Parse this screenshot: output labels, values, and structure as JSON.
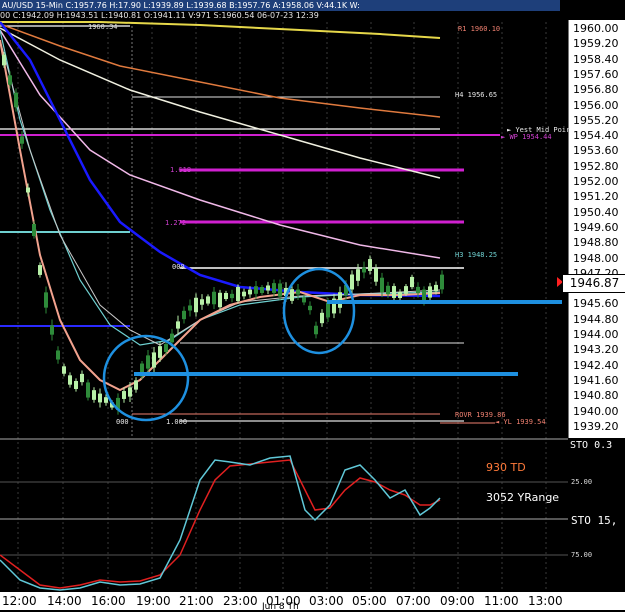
{
  "window": {
    "title": "AU/USD 15-Min  C:1957.76  H:17.90  L:1939.89  L:1939.68  B:1957.76  A:1958.06  V:44.1K  W:",
    "ohlc_line": "00  C:1942.09  H:1943.51  L:1940.81  O:1941.11  V:971  S:1960.54  06-07-23  12:39",
    "top_left_value": "1960.34"
  },
  "price_axis": {
    "labels": [
      "1960.00",
      "1959.20",
      "1958.40",
      "1957.60",
      "1956.80",
      "1956.00",
      "1955.20",
      "1954.40",
      "1953.60",
      "1952.80",
      "1952.00",
      "1951.20",
      "1950.40",
      "1949.60",
      "1948.80",
      "1948.00",
      "1947.20",
      "1946.40",
      "1945.60",
      "1944.80",
      "1944.00",
      "1943.20",
      "1942.40",
      "1941.60",
      "1940.80",
      "1940.00",
      "1939.20"
    ],
    "current_price": "1946.87"
  },
  "time_axis": {
    "labels": [
      "12:00",
      "14:00",
      "16:00",
      "19:00",
      "21:00",
      "23:00",
      "01:00",
      "03:00",
      "05:00",
      "07:00",
      "09:00",
      "11:00",
      "13:00"
    ],
    "footer_fragment": "Jun 8 Th"
  },
  "level_labels": {
    "r1": "R1 1960.10",
    "h4": "H4 1956.65",
    "yest_mid": "Yest Mid Poir",
    "wp": "WP 1954.44",
    "fib_1618": "1.618",
    "fib_1272": "1.272",
    "h3": "H3 1948.25",
    "fib_000_top": "000",
    "fib_000_bottom": "000",
    "fib_1000": "1.000",
    "rovr": "ROVR 1939.86",
    "yl": "YL 1939.54"
  },
  "stochastic": {
    "label_td": "930 TD",
    "label_range": "3052 YRange",
    "axis_top": "STO 0.3",
    "axis_25": "25.00",
    "axis_sto": "STO 15,",
    "axis_75": "75.00"
  },
  "colors": {
    "background": "#000000",
    "title_bar": "#1e3f7a",
    "candle_up": "#b8f0a8",
    "candle_down": "#2e8b3a",
    "ma_blue": "#1a1aff",
    "ma_orange": "#e07a3e",
    "ma_yellow": "#e6d84a",
    "ma_white": "#f0f0e0",
    "ma_pink": "#f0b8e8",
    "ma_salmon": "#f2a28e",
    "ma_teal": "#6fd0d0",
    "magenta_level": "#d020d0",
    "highlight_line": "#1e90e0",
    "sto_fast": "#60c8d8",
    "sto_slow": "#e02020",
    "td_text": "#ff7a3a"
  }
}
